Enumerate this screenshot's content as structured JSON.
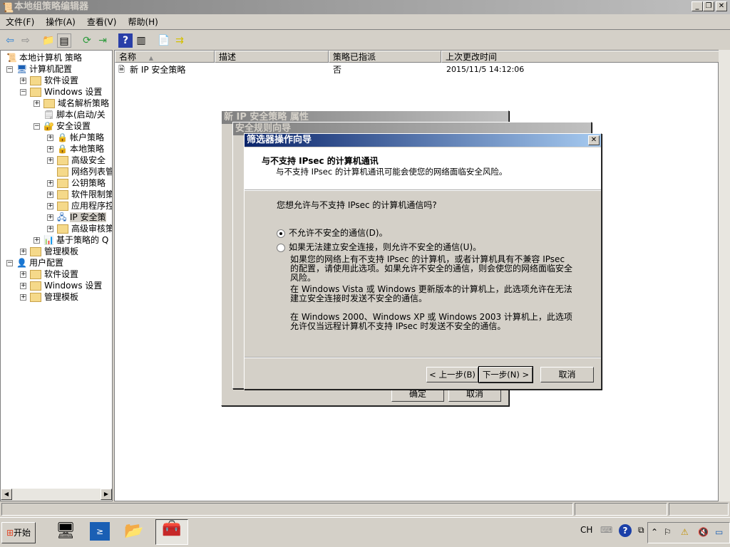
{
  "window": {
    "title": "本地组策略编辑器"
  },
  "menu": [
    "文件(F)",
    "操作(A)",
    "查看(V)",
    "帮助(H)"
  ],
  "tree": [
    {
      "label": "本地计算机 策略",
      "level": 0,
      "exp": "",
      "icon": "policy"
    },
    {
      "label": "计算机配置",
      "level": 0,
      "exp": "−",
      "icon": "computer"
    },
    {
      "label": "软件设置",
      "level": 1,
      "exp": "+",
      "icon": "folder"
    },
    {
      "label": "Windows 设置",
      "level": 1,
      "exp": "−",
      "icon": "folder"
    },
    {
      "label": "域名解析策略",
      "level": 2,
      "exp": "+",
      "icon": "folder"
    },
    {
      "label": "脚本(启动/关",
      "level": 2,
      "exp": "",
      "icon": "script"
    },
    {
      "label": "安全设置",
      "level": 2,
      "exp": "−",
      "icon": "security"
    },
    {
      "label": "帐户策略",
      "level": 3,
      "exp": "+",
      "icon": "folder-lock"
    },
    {
      "label": "本地策略",
      "level": 3,
      "exp": "+",
      "icon": "folder-lock"
    },
    {
      "label": "高级安全",
      "level": 3,
      "exp": "+",
      "icon": "folder"
    },
    {
      "label": "网络列表管",
      "level": 3,
      "exp": "",
      "icon": "folder"
    },
    {
      "label": "公钥策略",
      "level": 3,
      "exp": "+",
      "icon": "folder"
    },
    {
      "label": "软件限制策",
      "level": 3,
      "exp": "+",
      "icon": "folder"
    },
    {
      "label": "应用程序控",
      "level": 3,
      "exp": "+",
      "icon": "folder"
    },
    {
      "label": "IP 安全策",
      "level": 3,
      "exp": "+",
      "icon": "ipsec",
      "selected": true
    },
    {
      "label": "高级审核策",
      "level": 3,
      "exp": "+",
      "icon": "folder"
    },
    {
      "label": "基于策略的 Q",
      "level": 2,
      "exp": "+",
      "icon": "chart"
    },
    {
      "label": "管理模板",
      "level": 1,
      "exp": "+",
      "icon": "folder"
    },
    {
      "label": "用户配置",
      "level": 0,
      "exp": "−",
      "icon": "user"
    },
    {
      "label": "软件设置",
      "level": 1,
      "exp": "+",
      "icon": "folder"
    },
    {
      "label": "Windows 设置",
      "level": 1,
      "exp": "+",
      "icon": "folder"
    },
    {
      "label": "管理模板",
      "level": 1,
      "exp": "+",
      "icon": "folder"
    }
  ],
  "list": {
    "columns": [
      "名称",
      "描述",
      "策略已指派",
      "上次更改时间"
    ],
    "rows": [
      {
        "name": "新 IP 安全策略",
        "desc": "",
        "assigned": "否",
        "modified": "2015/11/5 14:12:06"
      }
    ]
  },
  "dialogs": {
    "props": {
      "title": "新 IP 安全策略 属性",
      "ok": "确定",
      "cancel": "取消"
    },
    "rule_wizard": {
      "title": "安全规则向导"
    },
    "filter_wizard": {
      "title": "筛选器操作向导",
      "heading": "与不支持 IPsec 的计算机通讯",
      "subheading": "与不支持 IPsec 的计算机通讯可能会使您的网络面临安全风险。",
      "question": "您想允许与不支持 IPsec 的计算机通信吗?",
      "option1": "不允许不安全的通信(D)。",
      "option2": "如果无法建立安全连接，则允许不安全的通信(U)。",
      "selected": "option1",
      "para1": "如果您的网络上有不支持 IPsec 的计算机，或者计算机具有不兼容 IPsec 的配置，请使用此选项。如果允许不安全的通信，则会使您的网络面临安全风险。",
      "para2": "在 Windows Vista 或 Windows 更新版本的计算机上，此选项允许在无法建立安全连接时发送不安全的通信。",
      "para3": "在 Windows 2000、Windows XP 或 Windows 2003 计算机上，此选项允许仅当远程计算机不支持 IPsec 时发送不安全的通信。",
      "back": "< 上一步(B)",
      "next": "下一步(N) >",
      "cancel": "取消"
    }
  },
  "taskbar": {
    "start": "开始",
    "lang": "CH"
  },
  "colors": {
    "active_title_start": "#0a246a",
    "active_title_end": "#a6caf0",
    "face": "#d4d0c8"
  }
}
